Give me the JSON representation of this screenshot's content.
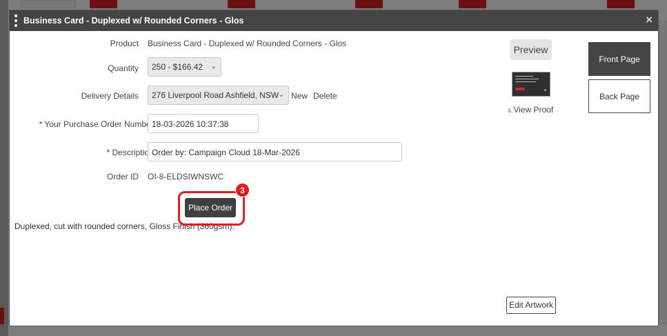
{
  "modal": {
    "title": "Business Card - Duplexed w/ Rounded Corners - Glos",
    "close_glyph": "×"
  },
  "form": {
    "product_label": "Product",
    "product_value": "Business Card - Duplexed w/ Rounded Corners - Glos",
    "quantity_label": "Quantity",
    "quantity_selected": "250 - $166.42",
    "delivery_label": "Delivery Details",
    "delivery_selected": "276 Liverpool Road Ashfield, NSW",
    "delivery_new": "New",
    "delivery_delete": "Delete",
    "po_label": "* Your Purchase Order Number:",
    "po_value": "18-03-2026 10:37:38",
    "description_label": "* Description:",
    "description_value": "Order by: Campaign Cloud 18-Mar-2026",
    "order_id_label": "Order ID",
    "order_id_value": "OI-8-ELDSIWNSWC",
    "place_order": "Place Order",
    "step_badge": "3",
    "product_description": "Duplexed, cut with rounded corners, Gloss Finish (360gsm)."
  },
  "preview": {
    "preview_label": "Preview",
    "view_proof": "View Proof",
    "front_page": "Front Page",
    "back_page": "Back Page",
    "edit_artwork": "Edit Artwork"
  },
  "colors": {
    "titlebar": "#444444",
    "highlight": "#e01b1b",
    "dark_button": "#3f3f3f"
  },
  "icons": [
    "drag-handle-icon",
    "close-icon",
    "chevron-down-icon"
  ]
}
